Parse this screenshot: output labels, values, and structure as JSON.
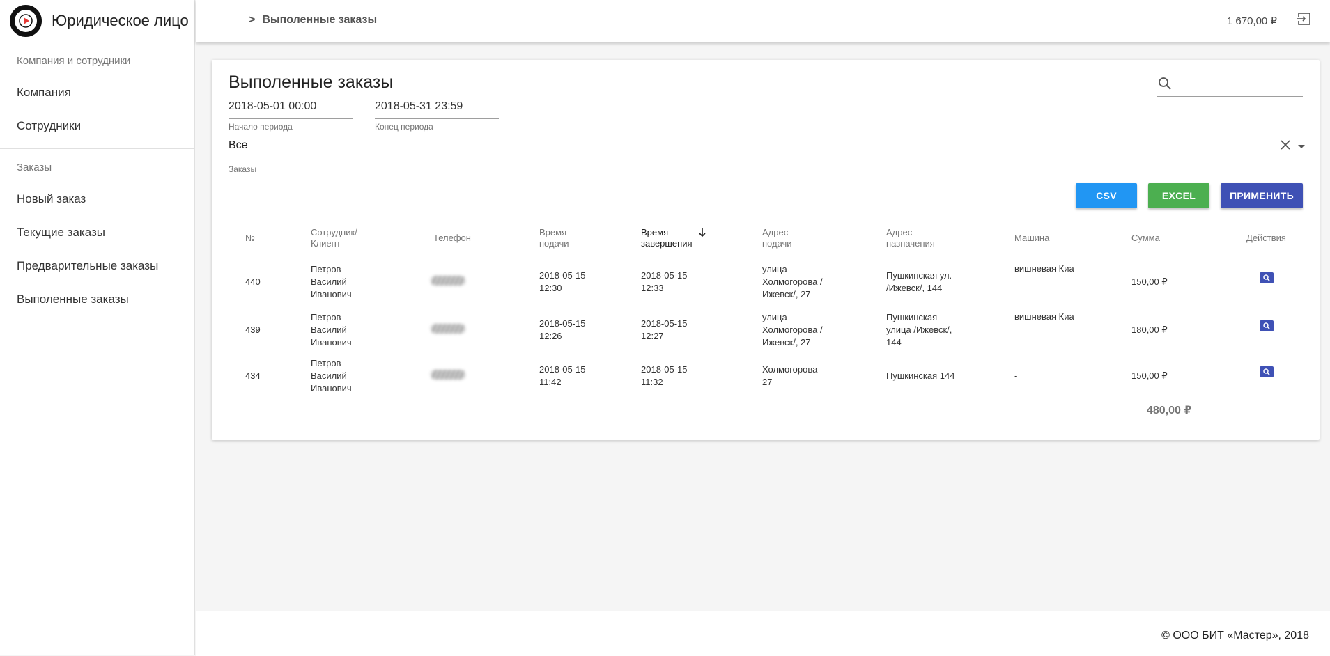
{
  "sidebar": {
    "brand": "Юридическое лицо",
    "sections": [
      {
        "title": "Компания и сотрудники",
        "items": [
          {
            "label": "Компания"
          },
          {
            "label": "Сотрудники"
          }
        ]
      },
      {
        "title": "Заказы",
        "items": [
          {
            "label": "Новый заказ"
          },
          {
            "label": "Текущие заказы"
          },
          {
            "label": "Предварительные заказы"
          },
          {
            "label": "Выполенные заказы"
          }
        ]
      }
    ]
  },
  "topbar": {
    "breadcrumb_sep": ">",
    "breadcrumb": "Выполенные заказы",
    "balance": "1 670,00 ₽",
    "logout_icon": "logout-icon"
  },
  "filters": {
    "title": "Выполенные заказы",
    "search_icon": "search-icon",
    "start_date": "2018-05-01 00:00",
    "start_label": "Начало периода",
    "end_date": "2018-05-31 23:59",
    "end_label": "Конец периода",
    "orders_value": "Все",
    "orders_label": "Заказы"
  },
  "buttons": {
    "csv": "CSV",
    "excel": "EXCEL",
    "apply": "ПРИМЕНИТЬ"
  },
  "colors": {
    "csv": "#2196f3",
    "excel": "#4caf50",
    "apply": "#3f51b5"
  },
  "table": {
    "headers": {
      "num": "№",
      "employee_line1": "Сотрудник/",
      "employee_line2": "Клиент",
      "phone": "Телефон",
      "pickup_time_line1": "Время",
      "pickup_time_line2": "подачи",
      "finish_time_line1": "Время",
      "finish_time_line2": "завершения",
      "pickup_addr_line1": "Адрес",
      "pickup_addr_line2": "подачи",
      "dest_addr_line1": "Адрес",
      "dest_addr_line2": "назначения",
      "car": "Машина",
      "sum": "Сумма",
      "actions": "Действия"
    },
    "sort_icon": "arrow-down-icon",
    "rows": [
      {
        "num": "440",
        "name1": "Петров",
        "name2": "Василий",
        "name3": "Иванович",
        "pickup_date": "2018-05-15",
        "pickup_time": "12:30",
        "finish_date": "2018-05-15",
        "finish_time": "12:33",
        "addr1": "улица",
        "addr2": "Холмогорова /",
        "addr3": "Ижевск/, 27",
        "dest1": "Пушкинская ул.",
        "dest2": "/Ижевск/, 144",
        "dest3": "",
        "car": "вишневая Киа",
        "sum": "150,00 ₽"
      },
      {
        "num": "439",
        "name1": "Петров",
        "name2": "Василий",
        "name3": "Иванович",
        "pickup_date": "2018-05-15",
        "pickup_time": "12:26",
        "finish_date": "2018-05-15",
        "finish_time": "12:27",
        "addr1": "улица",
        "addr2": "Холмогорова /",
        "addr3": "Ижевск/, 27",
        "dest1": "Пушкинская",
        "dest2": "улица /Ижевск/,",
        "dest3": "144",
        "car": "вишневая Киа",
        "sum": "180,00 ₽"
      },
      {
        "num": "434",
        "name1": "Петров",
        "name2": "Василий",
        "name3": "Иванович",
        "pickup_date": "2018-05-15",
        "pickup_time": "11:42",
        "finish_date": "2018-05-15",
        "finish_time": "11:32",
        "addr1": "Холмогорова",
        "addr2": "27",
        "addr3": "",
        "dest1": "Пушкинская 144",
        "dest2": "",
        "dest3": "",
        "car": "-",
        "sum": "150,00 ₽"
      }
    ],
    "total": "480,00 ₽"
  },
  "footer": {
    "copyright": "© ООО БИТ «Мастер», 2018"
  }
}
